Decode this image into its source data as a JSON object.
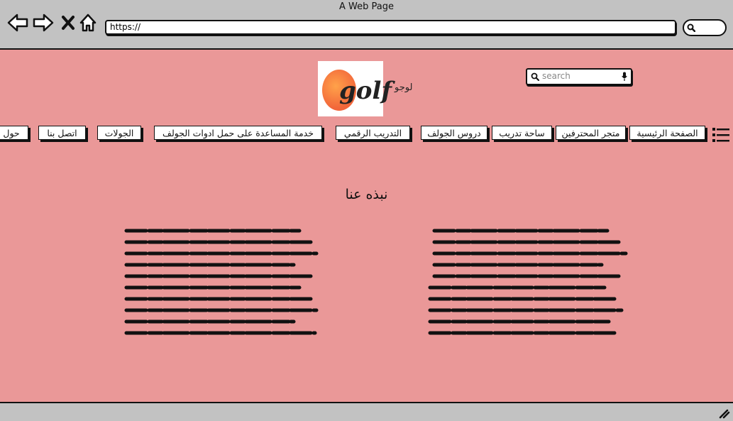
{
  "browser": {
    "window_title": "A Web Page",
    "url": "https://"
  },
  "header": {
    "logo_text": "golf",
    "logo_label": "لوجو",
    "search_placeholder": "search"
  },
  "nav": {
    "items": [
      "الصفحة الرئيسية",
      "متجر المحترفين",
      "ساحة تدريب",
      "دروس الجولف",
      "التدريب الرقمي",
      "خدمة المساعدة على حمل ادوات الجولف",
      "الجولات",
      "اتصل بنا",
      "حول"
    ]
  },
  "main": {
    "section_title": "نبذه عنا"
  },
  "colors": {
    "page_background": "#ea9898",
    "chrome": "#c2c2c2",
    "logo_orange": "#f2663a"
  }
}
